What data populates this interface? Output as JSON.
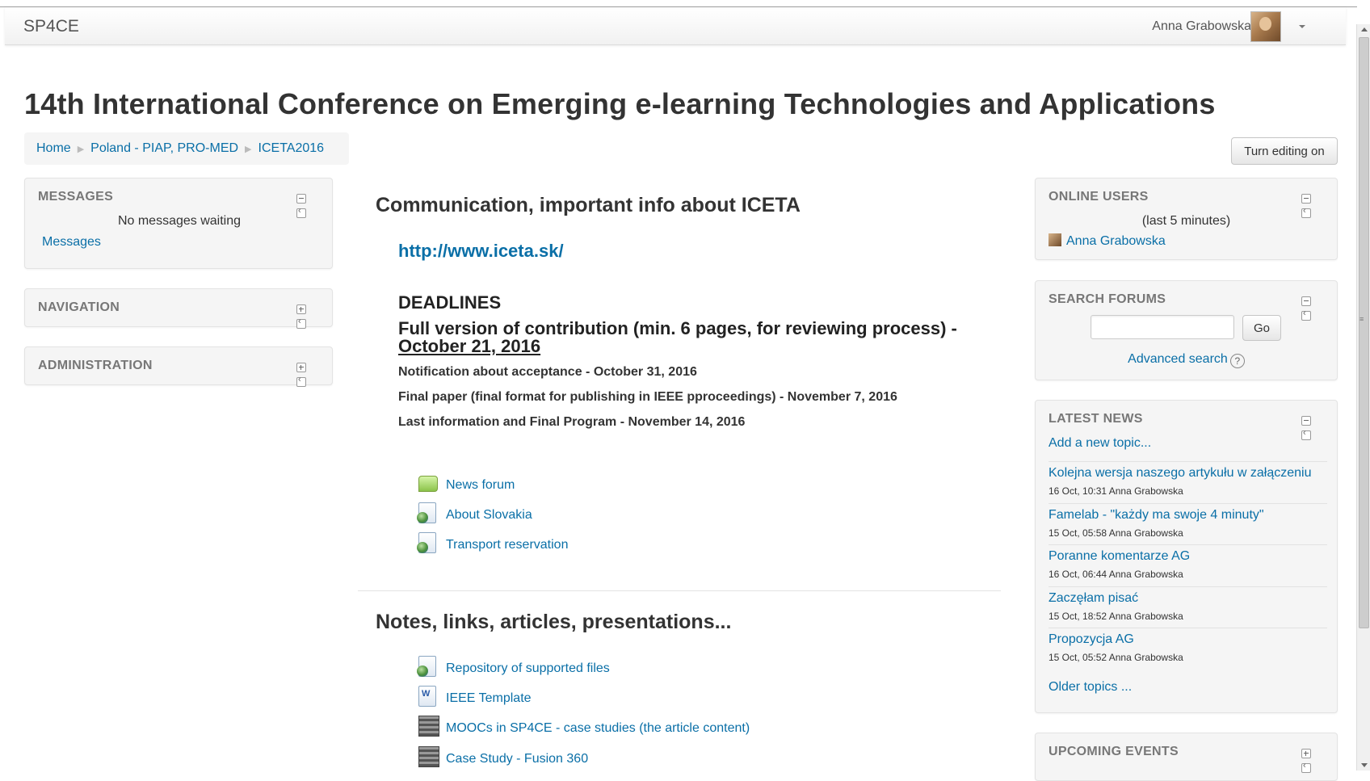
{
  "header": {
    "brand": "SP4CE",
    "user_name": "Anna Grabowska"
  },
  "page_title": "14th International Conference on Emerging e-learning Technologies and Applications",
  "breadcrumb": [
    "Home",
    "Poland - PIAP, PRO-MED",
    "ICETA2016"
  ],
  "turn_editing_label": "Turn editing on",
  "left_blocks": {
    "messages": {
      "title": "MESSAGES",
      "status": "No messages waiting",
      "link": "Messages"
    },
    "navigation": {
      "title": "NAVIGATION"
    },
    "administration": {
      "title": "ADMINISTRATION"
    }
  },
  "main": {
    "section1": {
      "title": "Communication, important info about ICETA",
      "url": "http://www.iceta.sk/",
      "deadlines_heading": "DEADLINES",
      "main_deadline_text": "Full version of contribution (min. 6 pages, for reviewing process) - ",
      "main_deadline_date": "October 21, 2016",
      "deadlines": [
        "Notification about acceptance - October 31, 2016",
        "Final paper (final format for publishing in IEEE pproceedings) - November 7, 2016",
        "Last information and Final Program - November 14, 2016"
      ],
      "activities": [
        {
          "label": "News forum",
          "icon": "forum-icon"
        },
        {
          "label": "About Slovakia",
          "icon": "page-icon"
        },
        {
          "label": "Transport reservation",
          "icon": "page-icon"
        }
      ]
    },
    "section2": {
      "title": "Notes, links, articles, presentations...",
      "activities": [
        {
          "label": "Repository of supported files",
          "icon": "page-icon"
        },
        {
          "label": "IEEE Template",
          "icon": "word-doc-icon"
        },
        {
          "label": "MOOCs in SP4CE - case studies (the article content)",
          "icon": "mooc-icon"
        },
        {
          "label": "Case Study - Fusion 360",
          "icon": "mooc-icon"
        }
      ]
    }
  },
  "right_blocks": {
    "online_users": {
      "title": "ONLINE USERS",
      "subtitle": "(last 5 minutes)",
      "user": "Anna Grabowska"
    },
    "search_forums": {
      "title": "SEARCH FORUMS",
      "go_label": "Go",
      "advanced": "Advanced search"
    },
    "latest_news": {
      "title": "LATEST NEWS",
      "add_topic": "Add a new topic...",
      "items": [
        {
          "title": "Kolejna wersja naszego artykułu w załączeniu",
          "meta": "16 Oct, 10:31  Anna Grabowska"
        },
        {
          "title": "Famelab - \"każdy ma swoje 4 minuty\"",
          "meta": "15 Oct, 05:58  Anna Grabowska"
        },
        {
          "title": "Poranne komentarze AG",
          "meta": "16 Oct, 06:44  Anna Grabowska"
        },
        {
          "title": "Zaczęłam pisać",
          "meta": "15 Oct, 18:52  Anna Grabowska"
        },
        {
          "title": "Propozycja AG",
          "meta": "15 Oct, 05:52  Anna Grabowska"
        }
      ],
      "older": "Older topics ..."
    },
    "upcoming_events": {
      "title": "UPCOMING EVENTS"
    }
  },
  "colors": {
    "link": "#0a6fa7",
    "text": "#333333",
    "block_bg": "#f5f5f5"
  }
}
